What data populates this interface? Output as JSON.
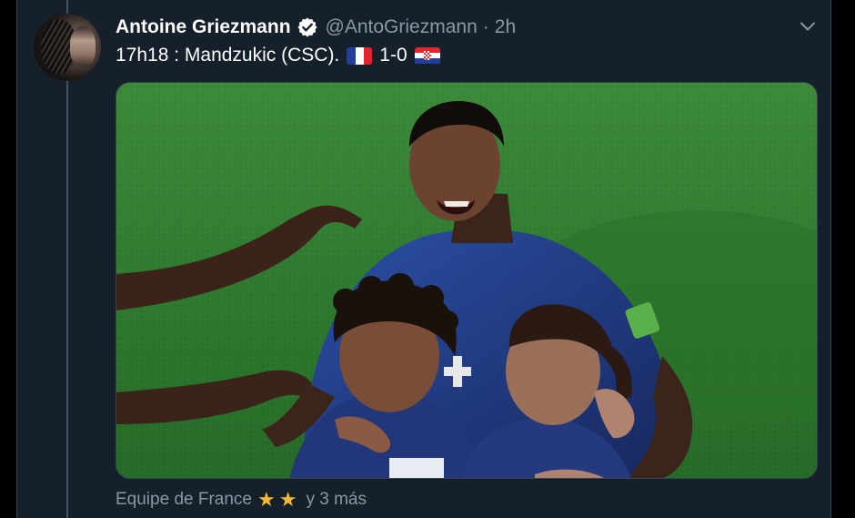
{
  "tweet": {
    "author_name": "Antoine Griezmann",
    "handle": "@AntoGriezmann",
    "separator": "·",
    "time": "2h",
    "verified": true,
    "text_main": "17h18 : Mandzukic (CSC).",
    "score": "1-0",
    "flags": [
      "flag-france-icon",
      "flag-croatia-icon"
    ]
  },
  "footer": {
    "team": "Equipe de France",
    "star_glyph": "★",
    "more": "y 3 más"
  },
  "colors": {
    "background": "#15202b",
    "border": "#38444d",
    "secondary_text": "#8899a6",
    "verified": "#ffffff",
    "star": "#f5b82e"
  }
}
